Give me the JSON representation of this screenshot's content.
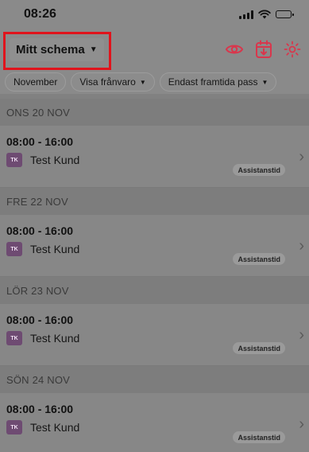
{
  "status_bar": {
    "time": "08:26"
  },
  "header": {
    "title": "Mitt schema",
    "accent_color": "#d9364c"
  },
  "icons": {
    "visibility": "eye-icon",
    "calendar_download": "calendar-download-icon",
    "brightness": "sun-icon"
  },
  "filters": [
    {
      "label": "November",
      "has_dropdown": false
    },
    {
      "label": "Visa frånvaro",
      "has_dropdown": true
    },
    {
      "label": "Endast framtida pass",
      "has_dropdown": true
    }
  ],
  "days": [
    {
      "header": "ONS 20 NOV",
      "shift": {
        "time": "08:00 - 16:00",
        "avatar": "TK",
        "customer": "Test Kund",
        "badge": "Assistanstid"
      }
    },
    {
      "header": "FRE 22 NOV",
      "shift": {
        "time": "08:00 - 16:00",
        "avatar": "TK",
        "customer": "Test Kund",
        "badge": "Assistanstid"
      }
    },
    {
      "header": "LÖR 23 NOV",
      "shift": {
        "time": "08:00 - 16:00",
        "avatar": "TK",
        "customer": "Test Kund",
        "badge": "Assistanstid"
      }
    },
    {
      "header": "SÖN 24 NOV",
      "shift": {
        "time": "08:00 - 16:00",
        "avatar": "TK",
        "customer": "Test Kund",
        "badge": "Assistanstid"
      }
    }
  ]
}
